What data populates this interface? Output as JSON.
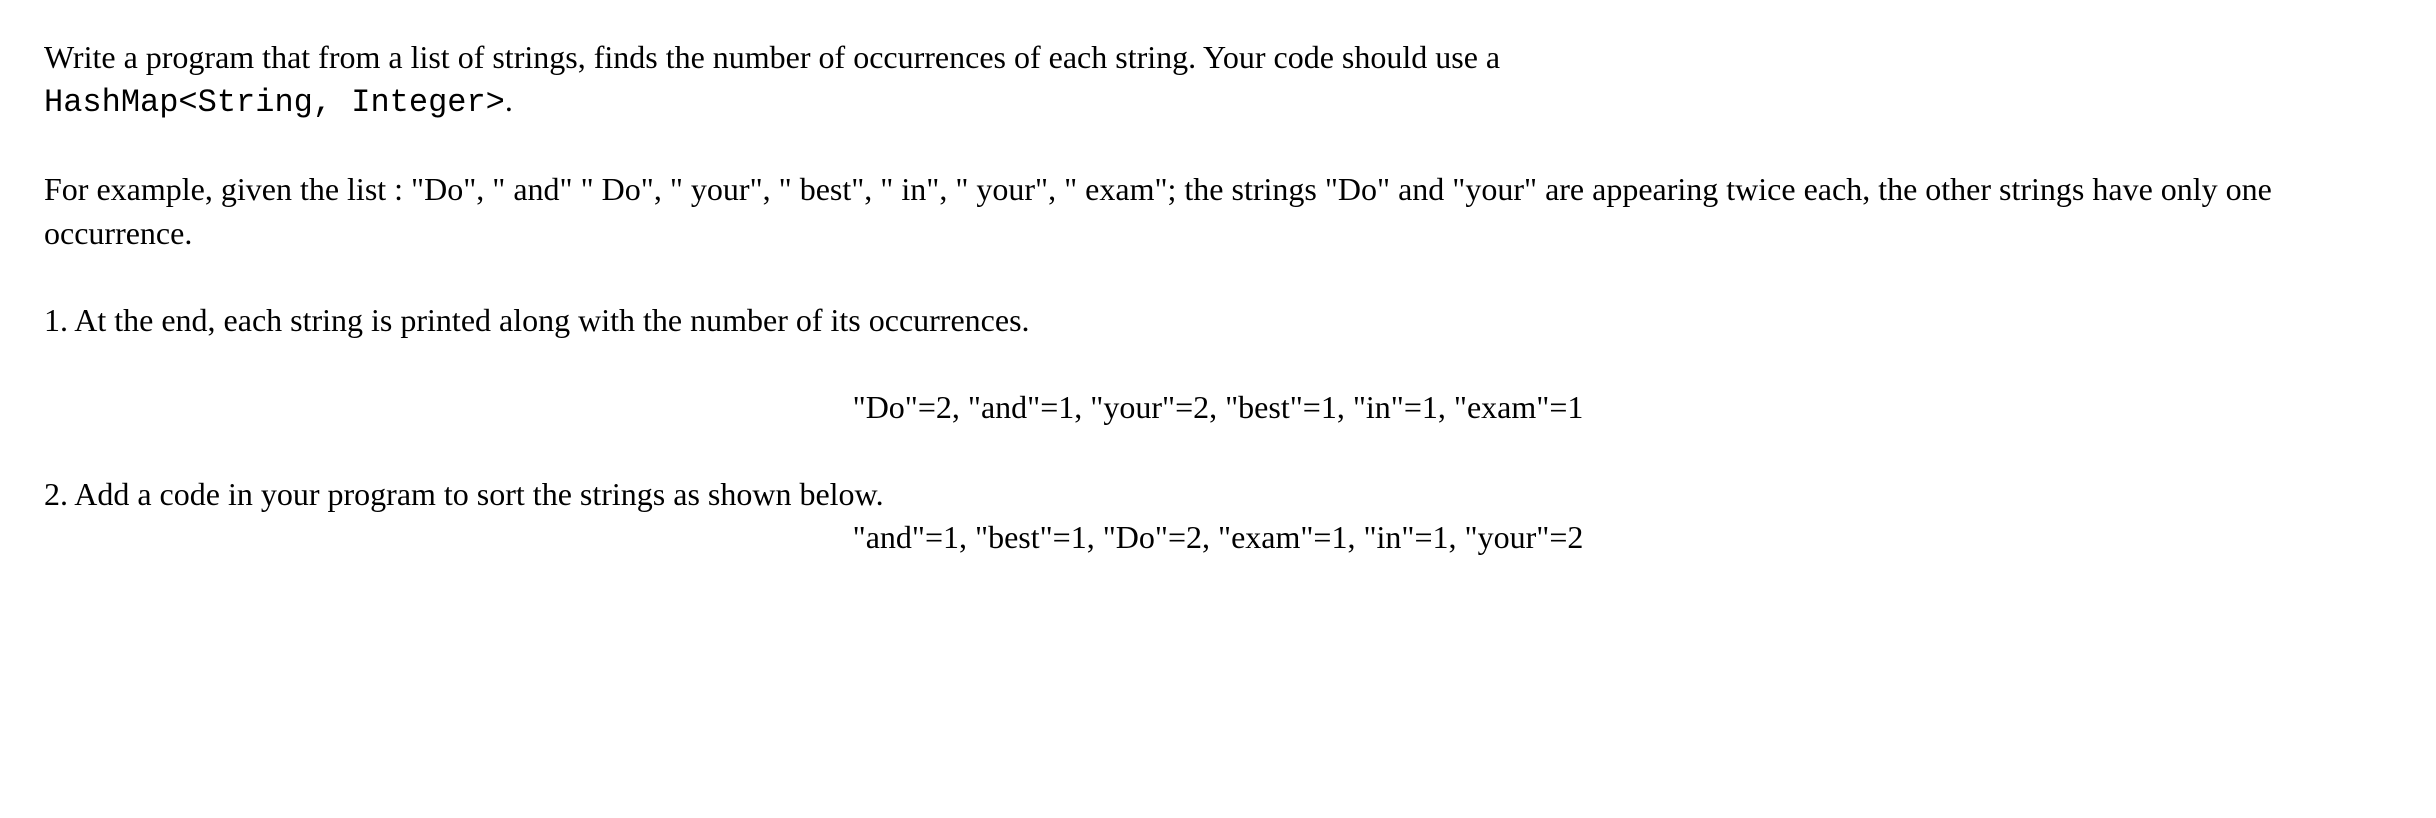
{
  "intro": {
    "line1_part1": "Write a program that from a list of strings, finds the number of occurrences of each string. Your code should use a ",
    "line2_code": "HashMap<String, Integer>",
    "line2_suffix": "."
  },
  "example": {
    "text": "For example, given the list : \"Do\", \" and\" \" Do\", \" your\", \" best\", \" in\", \" your\", \" exam\";  the strings \"Do\" and \"your\" are appearing twice each, the other strings have only one occurrence."
  },
  "item1": {
    "text": "1. At the end, each string is printed along with the number of its occurrences.",
    "output": "\"Do\"=2, \"and\"=1, \"your\"=2, \"best\"=1, \"in\"=1, \"exam\"=1"
  },
  "item2": {
    "text": "2. Add a code in your program to sort the strings as shown below.",
    "output": "\"and\"=1, \"best\"=1, \"Do\"=2, \"exam\"=1, \"in\"=1, \"your\"=2"
  }
}
